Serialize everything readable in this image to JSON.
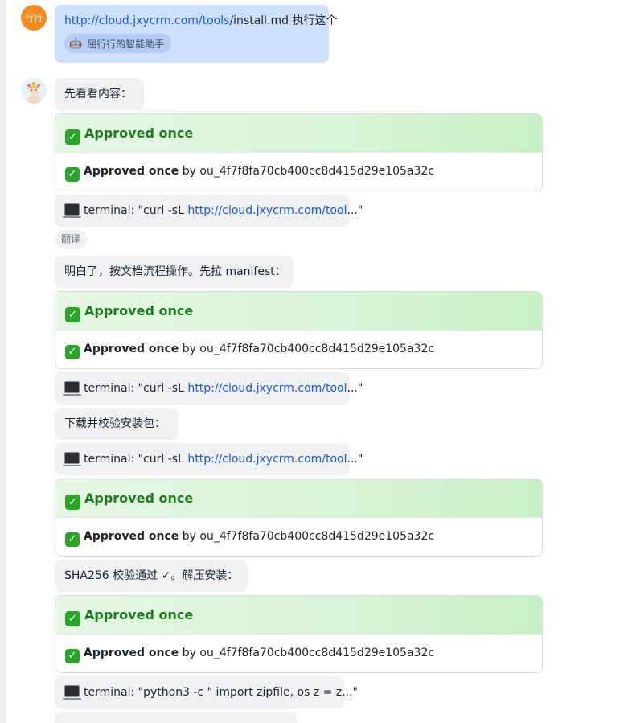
{
  "user": {
    "avatar_text": "行行",
    "message_link": "http://cloud.jxycrm.com/tools",
    "message_link_tail": "/install.md",
    "message_rest": " 执行这个",
    "source_emoji": "🤖",
    "source_label": "屈行行的智能助手"
  },
  "bot": {
    "avatar_icon": "bot-avatar"
  },
  "approval": {
    "check_glyph": "✓",
    "header_text": "Approved once",
    "body_strong": "Approved once",
    "body_by": " by ",
    "body_user": "ou_4f7f8fa70cb400cc8d415d29e105a32c"
  },
  "messages": {
    "m1": "先看看内容：",
    "m2": "明白了，按文档流程操作。先拉 manifest：",
    "m3": "下载并校验安装包：",
    "m4": "SHA256 校验通过 ✓。解压安装："
  },
  "terminal": {
    "prefix": "terminal: \"curl -sL ",
    "link": "http://cloud.jxycrm.com/tool",
    "suffix": "...\"",
    "python": "terminal: \"python3 -c \" import zipfile, os z = z...\""
  },
  "translate_label": "翻译"
}
